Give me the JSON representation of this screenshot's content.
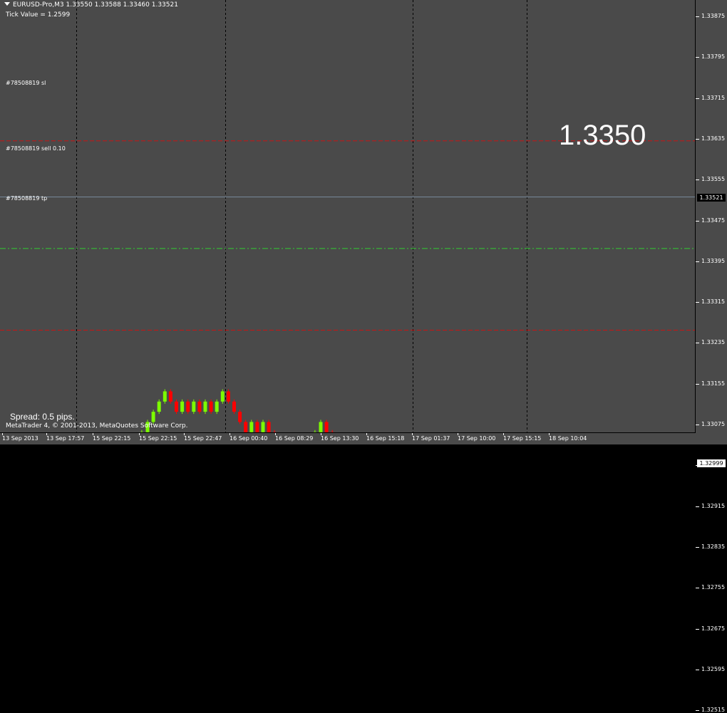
{
  "header": {
    "symbol_info": "EURUSD-Pro,M3  1.33550 1.33588 1.33460 1.33521",
    "tick_value": "Tick Value = 1.2599"
  },
  "lines": {
    "sl_label": "#78508819 sl",
    "sell_label": "#78508819 sell 0.10",
    "tp_label": "#78508819 tp",
    "sl_price": 1.33631,
    "sell_price": 1.3342,
    "tp_price": 1.3326,
    "bid_price": 1.33521,
    "white_line_price": 1.32999
  },
  "big_price": "1.3350",
  "spread_text": "Spread: 0.5 pips.",
  "copyright": "MetaTrader 4, © 2001-2013, MetaQuotes Software Corp.",
  "price_axis": {
    "labels": [
      "1.33875",
      "1.33795",
      "1.33715",
      "1.33635",
      "1.33555",
      "1.33475",
      "1.33395",
      "1.33315",
      "1.33235",
      "1.33155",
      "1.33075",
      "1.32995",
      "1.32915",
      "1.32835",
      "1.32755",
      "1.32675",
      "1.32595",
      "1.32515"
    ],
    "current_price_label": "1.33521",
    "white_price_label": "1.32999"
  },
  "time_axis": {
    "labels": [
      "13 Sep 2013",
      "13 Sep 17:57",
      "15 Sep 22:15",
      "15 Sep 22:15",
      "15 Sep 22:47",
      "16 Sep 00:40",
      "16 Sep 08:29",
      "16 Sep 13:30",
      "16 Sep 15:18",
      "17 Sep 01:37",
      "17 Sep 10:00",
      "17 Sep 15:15",
      "18 Sep 10:04"
    ]
  },
  "colors": {
    "background": "#4a4a4a",
    "bull": "#7cfc00",
    "bear": "#ff0000",
    "sl_tp_line": "#c81414",
    "sell_line": "#32cd32",
    "bid_line": "#778899",
    "grid": "#000000"
  },
  "chart_data": {
    "type": "renko",
    "brick_size": 0.0002,
    "start_price": 1.3264,
    "directions": [
      1,
      -1,
      -1,
      1,
      1,
      1,
      1,
      1,
      1,
      1,
      1,
      1,
      1,
      1,
      1,
      1,
      1,
      1,
      1,
      1,
      1,
      1,
      1,
      1,
      1,
      1,
      1,
      1,
      1,
      -1,
      -1,
      1,
      -1,
      1,
      -1,
      1,
      -1,
      1,
      1,
      -1,
      -1,
      -1,
      -1,
      1,
      -1,
      1,
      -1,
      -1,
      -1,
      -1,
      -1,
      1,
      1,
      1,
      1,
      1,
      -1,
      -1,
      -1,
      -1,
      -1,
      -1,
      1,
      -1,
      -1,
      -1,
      -1,
      1,
      -1,
      1,
      1,
      1,
      1,
      -1,
      1,
      -1,
      1,
      -1,
      1,
      -1,
      -1,
      -1
    ]
  }
}
